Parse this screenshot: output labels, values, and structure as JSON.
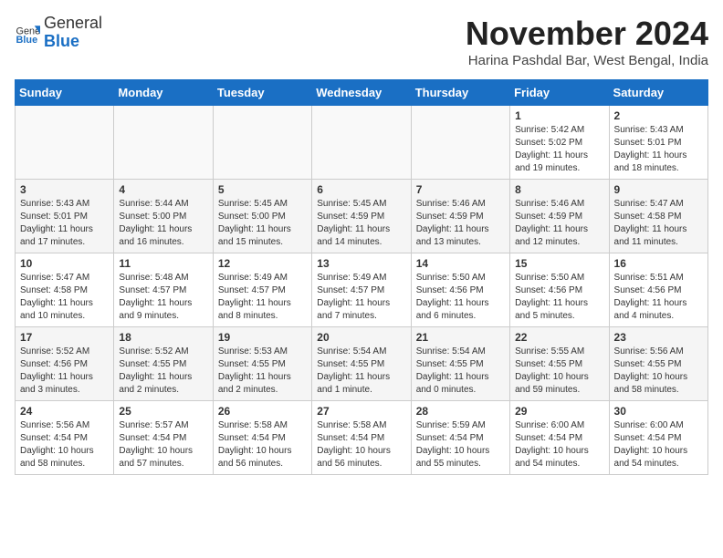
{
  "header": {
    "logo_general": "General",
    "logo_blue": "Blue",
    "month_title": "November 2024",
    "location": "Harina Pashdal Bar, West Bengal, India"
  },
  "days_of_week": [
    "Sunday",
    "Monday",
    "Tuesday",
    "Wednesday",
    "Thursday",
    "Friday",
    "Saturday"
  ],
  "weeks": [
    [
      {
        "day": "",
        "info": ""
      },
      {
        "day": "",
        "info": ""
      },
      {
        "day": "",
        "info": ""
      },
      {
        "day": "",
        "info": ""
      },
      {
        "day": "",
        "info": ""
      },
      {
        "day": "1",
        "info": "Sunrise: 5:42 AM\nSunset: 5:02 PM\nDaylight: 11 hours and 19 minutes."
      },
      {
        "day": "2",
        "info": "Sunrise: 5:43 AM\nSunset: 5:01 PM\nDaylight: 11 hours and 18 minutes."
      }
    ],
    [
      {
        "day": "3",
        "info": "Sunrise: 5:43 AM\nSunset: 5:01 PM\nDaylight: 11 hours and 17 minutes."
      },
      {
        "day": "4",
        "info": "Sunrise: 5:44 AM\nSunset: 5:00 PM\nDaylight: 11 hours and 16 minutes."
      },
      {
        "day": "5",
        "info": "Sunrise: 5:45 AM\nSunset: 5:00 PM\nDaylight: 11 hours and 15 minutes."
      },
      {
        "day": "6",
        "info": "Sunrise: 5:45 AM\nSunset: 4:59 PM\nDaylight: 11 hours and 14 minutes."
      },
      {
        "day": "7",
        "info": "Sunrise: 5:46 AM\nSunset: 4:59 PM\nDaylight: 11 hours and 13 minutes."
      },
      {
        "day": "8",
        "info": "Sunrise: 5:46 AM\nSunset: 4:59 PM\nDaylight: 11 hours and 12 minutes."
      },
      {
        "day": "9",
        "info": "Sunrise: 5:47 AM\nSunset: 4:58 PM\nDaylight: 11 hours and 11 minutes."
      }
    ],
    [
      {
        "day": "10",
        "info": "Sunrise: 5:47 AM\nSunset: 4:58 PM\nDaylight: 11 hours and 10 minutes."
      },
      {
        "day": "11",
        "info": "Sunrise: 5:48 AM\nSunset: 4:57 PM\nDaylight: 11 hours and 9 minutes."
      },
      {
        "day": "12",
        "info": "Sunrise: 5:49 AM\nSunset: 4:57 PM\nDaylight: 11 hours and 8 minutes."
      },
      {
        "day": "13",
        "info": "Sunrise: 5:49 AM\nSunset: 4:57 PM\nDaylight: 11 hours and 7 minutes."
      },
      {
        "day": "14",
        "info": "Sunrise: 5:50 AM\nSunset: 4:56 PM\nDaylight: 11 hours and 6 minutes."
      },
      {
        "day": "15",
        "info": "Sunrise: 5:50 AM\nSunset: 4:56 PM\nDaylight: 11 hours and 5 minutes."
      },
      {
        "day": "16",
        "info": "Sunrise: 5:51 AM\nSunset: 4:56 PM\nDaylight: 11 hours and 4 minutes."
      }
    ],
    [
      {
        "day": "17",
        "info": "Sunrise: 5:52 AM\nSunset: 4:56 PM\nDaylight: 11 hours and 3 minutes."
      },
      {
        "day": "18",
        "info": "Sunrise: 5:52 AM\nSunset: 4:55 PM\nDaylight: 11 hours and 2 minutes."
      },
      {
        "day": "19",
        "info": "Sunrise: 5:53 AM\nSunset: 4:55 PM\nDaylight: 11 hours and 2 minutes."
      },
      {
        "day": "20",
        "info": "Sunrise: 5:54 AM\nSunset: 4:55 PM\nDaylight: 11 hours and 1 minute."
      },
      {
        "day": "21",
        "info": "Sunrise: 5:54 AM\nSunset: 4:55 PM\nDaylight: 11 hours and 0 minutes."
      },
      {
        "day": "22",
        "info": "Sunrise: 5:55 AM\nSunset: 4:55 PM\nDaylight: 10 hours and 59 minutes."
      },
      {
        "day": "23",
        "info": "Sunrise: 5:56 AM\nSunset: 4:55 PM\nDaylight: 10 hours and 58 minutes."
      }
    ],
    [
      {
        "day": "24",
        "info": "Sunrise: 5:56 AM\nSunset: 4:54 PM\nDaylight: 10 hours and 58 minutes."
      },
      {
        "day": "25",
        "info": "Sunrise: 5:57 AM\nSunset: 4:54 PM\nDaylight: 10 hours and 57 minutes."
      },
      {
        "day": "26",
        "info": "Sunrise: 5:58 AM\nSunset: 4:54 PM\nDaylight: 10 hours and 56 minutes."
      },
      {
        "day": "27",
        "info": "Sunrise: 5:58 AM\nSunset: 4:54 PM\nDaylight: 10 hours and 56 minutes."
      },
      {
        "day": "28",
        "info": "Sunrise: 5:59 AM\nSunset: 4:54 PM\nDaylight: 10 hours and 55 minutes."
      },
      {
        "day": "29",
        "info": "Sunrise: 6:00 AM\nSunset: 4:54 PM\nDaylight: 10 hours and 54 minutes."
      },
      {
        "day": "30",
        "info": "Sunrise: 6:00 AM\nSunset: 4:54 PM\nDaylight: 10 hours and 54 minutes."
      }
    ]
  ]
}
